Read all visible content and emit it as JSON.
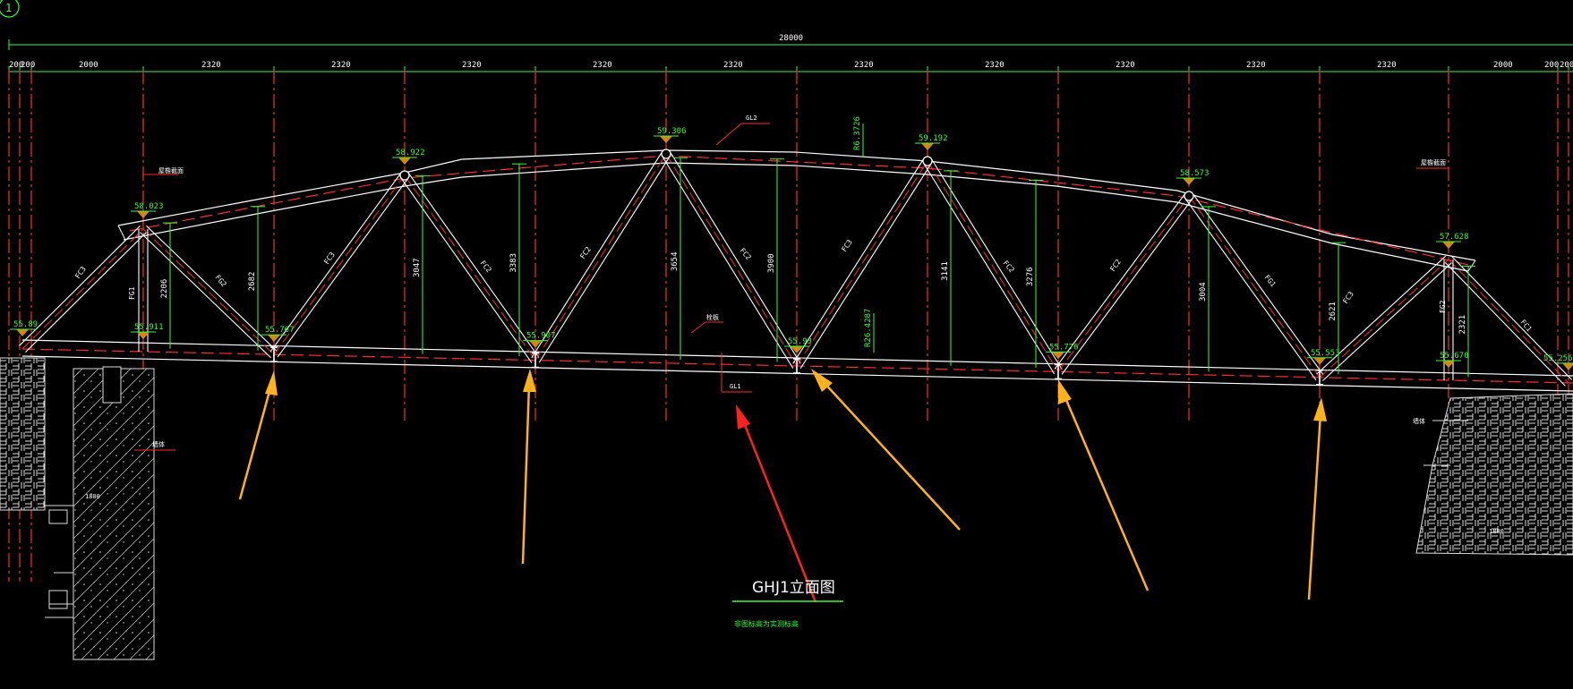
{
  "drawing": {
    "grid_bubble_label": "1",
    "overall_dim": "28000",
    "segment_dims": [
      "200",
      "200",
      "2000",
      "2320",
      "2320",
      "2320",
      "2320",
      "2320",
      "2320",
      "2320",
      "2320",
      "2320",
      "2320",
      "2000",
      "200",
      "200"
    ],
    "title": "GHJ1立面图",
    "subtitle": "非图标高为实测标高"
  },
  "elevations_top": [
    "58.023",
    "58.922",
    "59.306",
    "59.192",
    "58.573",
    "57.628"
  ],
  "elevations_bottom": [
    "55.89",
    "55.911",
    "55.767",
    "55.907",
    "55.93",
    "55.776",
    "55.553",
    "55.670",
    "55.256"
  ],
  "heights": [
    "2206",
    "2682",
    "3047",
    "3383",
    "3654",
    "3900",
    "3141",
    "3276",
    "3004",
    "2621",
    "2321"
  ],
  "member_labels": [
    "FG1",
    "FC3",
    "FG2",
    "FC3",
    "FC2",
    "FC2",
    "FC2",
    "FC3",
    "FC2",
    "FC2",
    "FG1",
    "FG2",
    "FC3",
    "FC1"
  ],
  "callouts": {
    "top_chord": "GL2",
    "bottom_chord": "GL1",
    "radius_top": "R6.3726",
    "radius_bottom": "R26.4287",
    "left_support": "屋檐截面",
    "right_support": "屋檐截面",
    "mid_note": "栓板",
    "left_wall": "1800",
    "right_wall_label": "墙体",
    "right_wall_dim": "1800"
  },
  "colors": {
    "background": "#000000",
    "truss": "#ffffff",
    "dimension": "#33ff33",
    "axis": "#ff2a2a",
    "arrow_yellow": "#ffb21a",
    "arrow_red": "#ff2020",
    "marker": "#d4880e"
  }
}
